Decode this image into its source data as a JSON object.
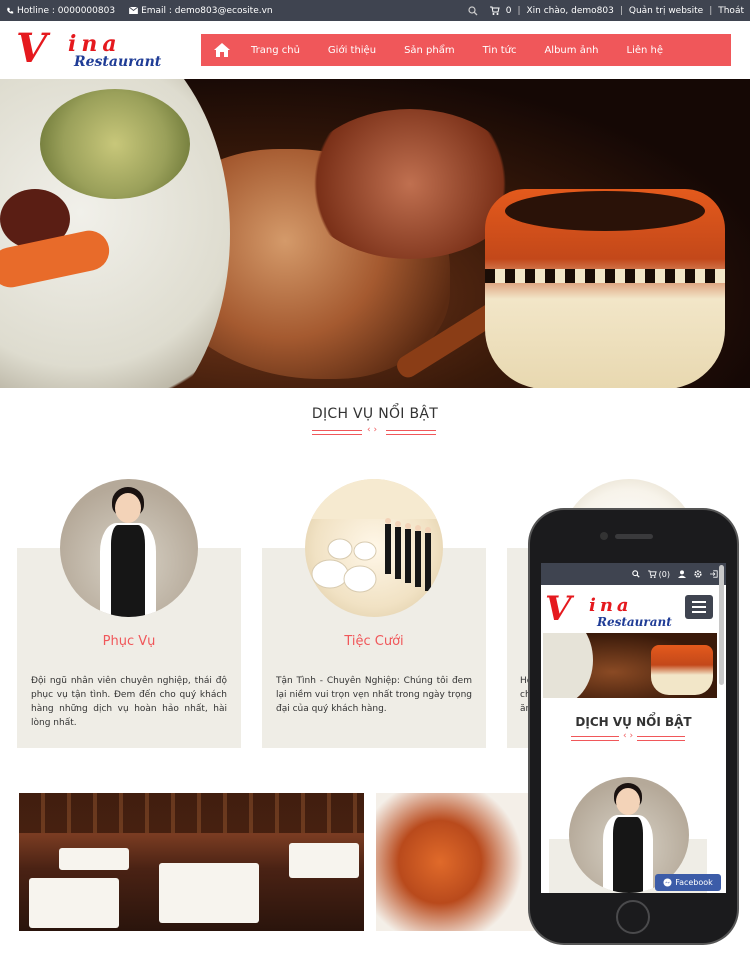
{
  "topbar": {
    "hotline": "Hotline : 0000000803",
    "email": "Email : demo803@ecosite.vn",
    "cart_count": "0",
    "greeting": "Xin chào, demo803",
    "admin": "Quản trị website",
    "logout": "Thoát"
  },
  "logo": {
    "v": "V",
    "ina": "ina",
    "rest": "Restaurant"
  },
  "nav": {
    "items": [
      "Trang chủ",
      "Giới thiệu",
      "Sản phẩm",
      "Tin tức",
      "Album ảnh",
      "Liên hệ"
    ]
  },
  "section": {
    "title": "DỊCH VỤ NỔI BẬT",
    "arrows": "‹ ›"
  },
  "cards": [
    {
      "title": "Phục Vụ",
      "text": "Đội ngũ nhân viên chuyên nghiệp, thái độ phục vụ tận tình. Đem đến cho quý khách hàng những dịch vụ hoàn hảo nhất, hài lòng nhất."
    },
    {
      "title": "Tiệc Cưới",
      "text": "Tận Tình - Chuyên Nghiệp: Chúng tôi đem lại niềm vui trọn vẹn nhất trong ngày trọng đại của quý khách hàng."
    },
    {
      "title": "",
      "text": "Hơ ch ăn"
    }
  ],
  "mobile": {
    "cart": "(0)",
    "title": "DỊCH VỤ NỔI BẬT",
    "facebook": "Facebook"
  },
  "colors": {
    "accent": "#f0575a",
    "topbar": "#3f4450",
    "card_bg": "#efede6",
    "logo_red": "#e5191e",
    "logo_blue": "#1f3c96"
  }
}
